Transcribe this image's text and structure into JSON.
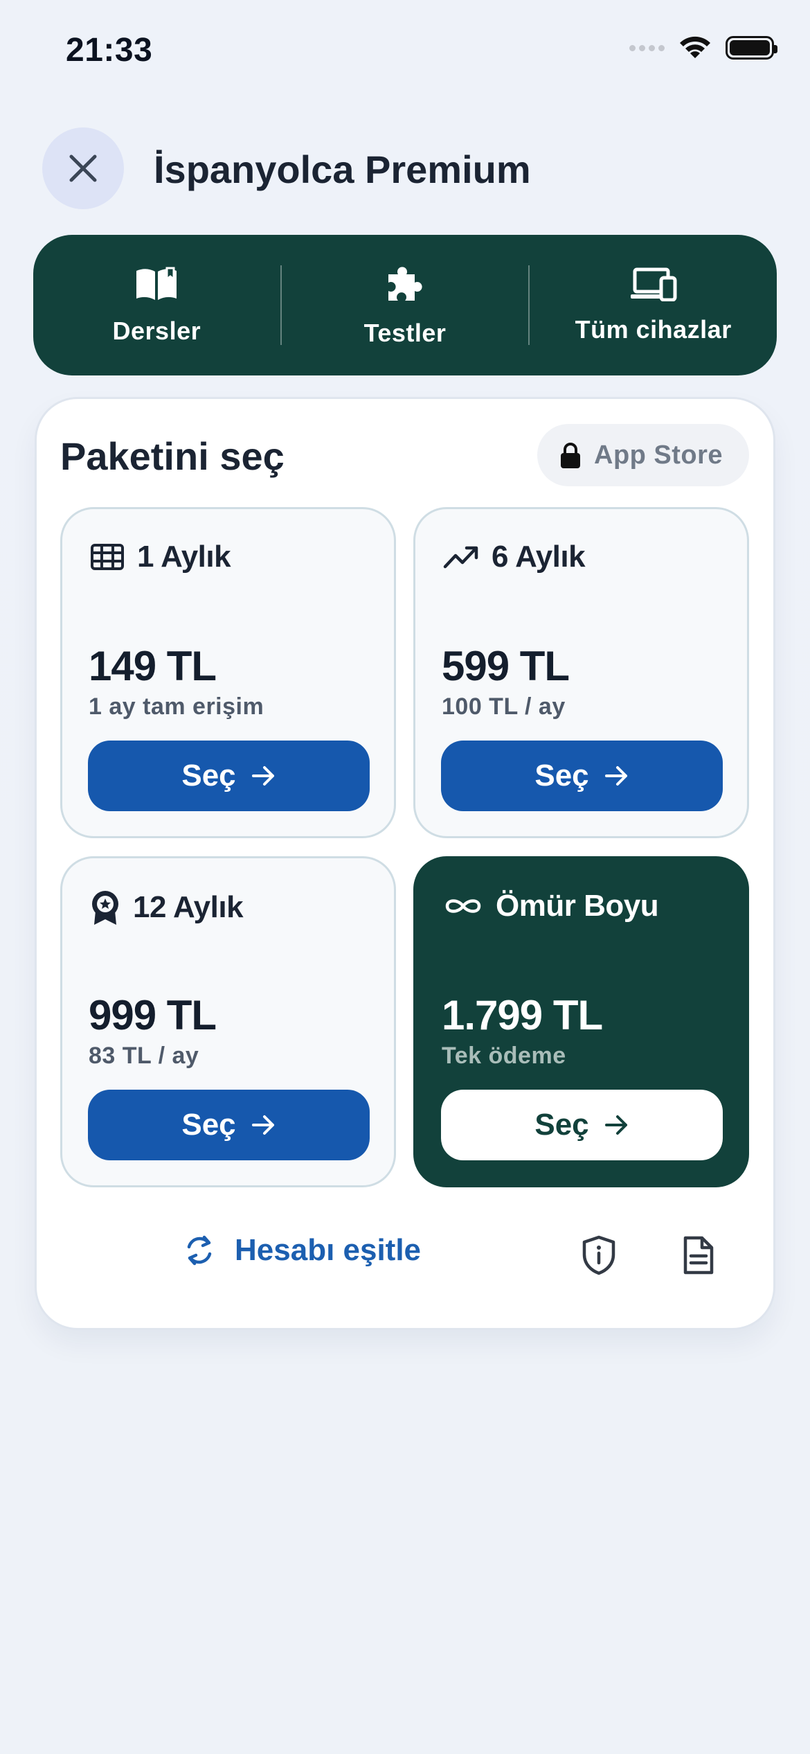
{
  "status_bar": {
    "time": "21:33"
  },
  "header": {
    "title": "İspanyolca Premium"
  },
  "features": [
    {
      "label": "Dersler",
      "icon": "open-book-icon"
    },
    {
      "label": "Testler",
      "icon": "puzzle-icon"
    },
    {
      "label": "Tüm cihazlar",
      "icon": "devices-icon"
    }
  ],
  "plans_section": {
    "title": "Paketini seç",
    "store_label": "App Store"
  },
  "plans": [
    {
      "name": "1 Aylık",
      "price": "149 TL",
      "subtitle": "1 ay tam erişim",
      "button": "Seç",
      "icon": "grid-icon"
    },
    {
      "name": "6 Aylık",
      "price": "599 TL",
      "subtitle": "100 TL / ay",
      "button": "Seç",
      "icon": "trending-up-icon"
    },
    {
      "name": "12 Aylık",
      "price": "999 TL",
      "subtitle": "83 TL / ay",
      "button": "Seç",
      "icon": "award-icon"
    },
    {
      "name": "Ömür Boyu",
      "price": "1.799 TL",
      "subtitle": "Tek ödeme",
      "button": "Seç",
      "icon": "infinity-icon",
      "highlighted": true
    }
  ],
  "footer": {
    "sync_label": "Hesabı eşitle"
  },
  "colors": {
    "brand_dark": "#12413b",
    "primary_blue": "#1658ad",
    "background": "#eef2f8"
  }
}
